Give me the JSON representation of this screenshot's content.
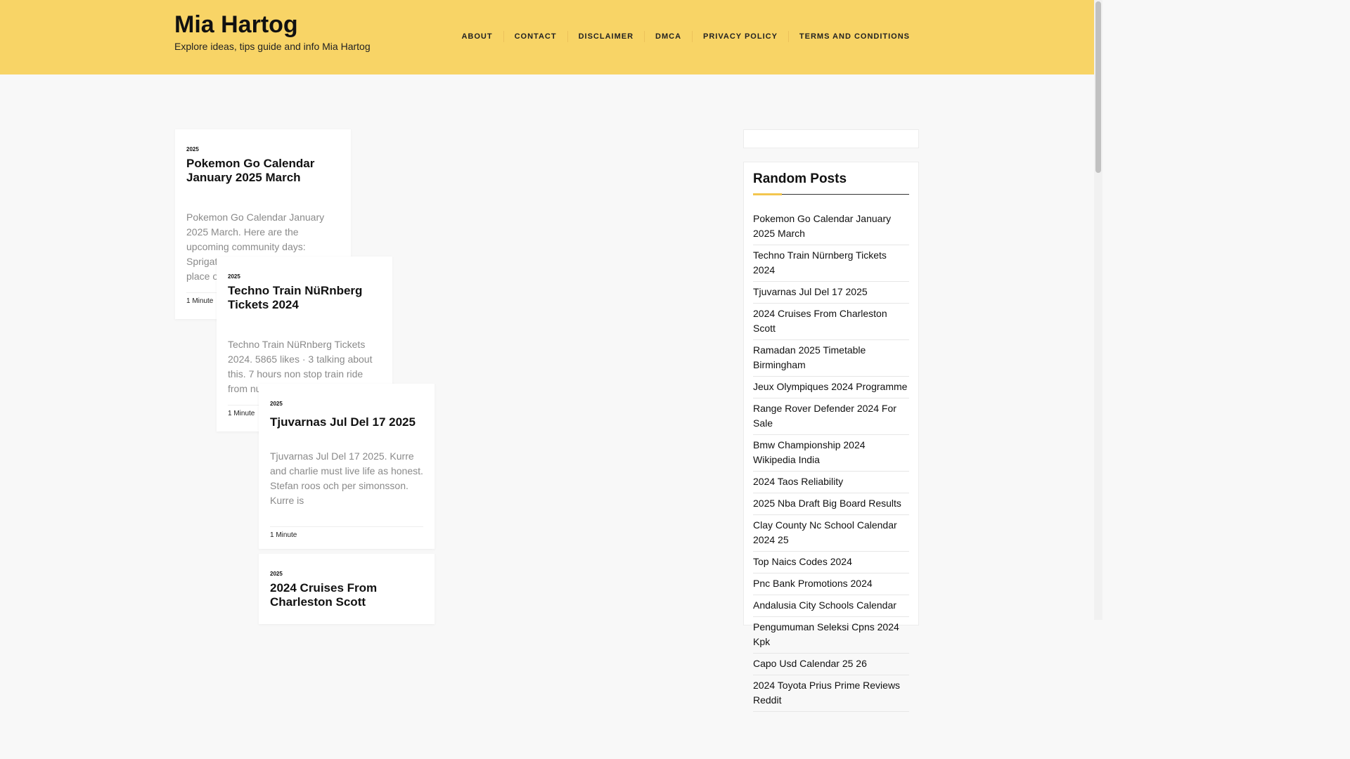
{
  "site": {
    "title": "Mia Hartog",
    "tagline": "Explore ideas, tips guide and info Mia Hartog"
  },
  "nav": {
    "items": [
      "ABOUT",
      "CONTACT",
      "DISCLAIMER",
      "DMCA",
      "PRIVACY POLICY",
      "TERMS AND CONDITIONS"
    ]
  },
  "posts": [
    {
      "category": "2025",
      "title": "Pokemon Go Calendar January 2025 March",
      "excerpt": "Pokemon Go Calendar January 2025 March. Here are the upcoming community days: Sprigatito community day takes place on sunday,",
      "reading_time": "1 Minute"
    },
    {
      "category": "2025",
      "title": "Techno Train NüRnberg Tickets 2024",
      "excerpt": "Techno Train NüRnberg Tickets 2024. 5865 likes · 3 talking about this. 7 hours non stop train ride from nuremberg",
      "reading_time": "1 Minute"
    },
    {
      "category": "2025",
      "title": "Tjuvarnas Jul Del 17 2025",
      "excerpt": "Tjuvarnas Jul Del 17 2025. Kurre and charlie must live life as honest. Stefan roos och per simonsson. Kurre is",
      "reading_time": "1 Minute"
    },
    {
      "category": "2025",
      "title": "2024 Cruises From Charleston Scott",
      "excerpt": "",
      "reading_time": ""
    }
  ],
  "sidebar": {
    "random_posts": {
      "title": "Random Posts",
      "items": [
        "Pokemon Go Calendar January 2025 March",
        "Techno Train Nürnberg Tickets 2024",
        "Tjuvarnas Jul Del 17 2025",
        "2024 Cruises From Charleston Scott",
        "Ramadan 2025 Timetable Birmingham",
        "Jeux Olympiques 2024 Programme",
        "Range Rover Defender 2024 For Sale",
        "Bmw Championship 2024 Wikipedia India",
        "2024 Taos Reliability",
        "2025 Nba Draft Big Board Results",
        "Clay County Nc School Calendar 2024 25",
        "Top Naics Codes 2024",
        "Pnc Bank Promotions 2024",
        "Andalusia City Schools Calendar",
        "Pengumuman Seleksi Cpns 2024 Kpk",
        "Capo Usd Calendar 25 26",
        "2024 Toyota Prius Prime Reviews Reddit"
      ]
    }
  },
  "colors": {
    "header_bg": "#f8d466",
    "page_bg": "#f8f8f8",
    "accent": "#f3c64e"
  }
}
